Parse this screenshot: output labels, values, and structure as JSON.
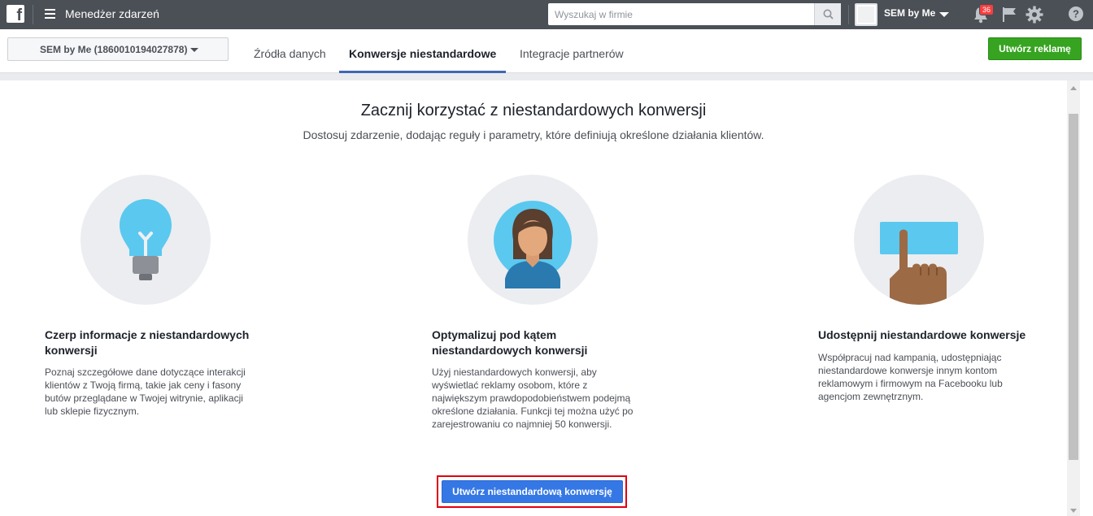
{
  "topbar": {
    "logo": "f",
    "app_title": "Menedżer zdarzeń",
    "search_placeholder": "Wyszukaj w firmie",
    "account_name": "SEM by Me",
    "notification_count": "36",
    "icons": [
      "facebook-logo",
      "menu-icon",
      "search-icon",
      "bell-icon",
      "flag-icon",
      "gear-icon",
      "help-icon"
    ]
  },
  "subnav": {
    "account_select": "SEM by Me (1860010194027878)",
    "tabs": [
      {
        "label": "Źródła danych",
        "active": false
      },
      {
        "label": "Konwersje niestandardowe",
        "active": true
      },
      {
        "label": "Integracje partnerów",
        "active": false
      }
    ],
    "create_ad": "Utwórz reklamę"
  },
  "main": {
    "headline": "Zacznij korzystać z niestandardowych konwersji",
    "subline": "Dostosuj zdarzenie, dodając reguły i parametry, które definiują określone działania klientów.",
    "cards": [
      {
        "icon": "lightbulb-icon",
        "title_lines": [
          "Czerp informacje z niestandardowych",
          "konwersji"
        ],
        "text_lines": [
          "Poznaj szczegółowe dane dotyczące interakcji",
          "klientów z Twoją firmą, takie jak ceny i fasony",
          "butów przeglądane w Twojej witrynie, aplikacji",
          "lub sklepie fizycznym."
        ]
      },
      {
        "icon": "person-icon",
        "title_lines": [
          "Optymalizuj pod kątem",
          "niestandardowych konwersji"
        ],
        "text_lines": [
          "Użyj niestandardowych konwersji, aby",
          "wyświetlać reklamy osobom, które z",
          "największym prawdopodobieństwem podejmą",
          "określone działania. Funkcji tej można użyć po",
          "zarejestrowaniu co najmniej 50 konwersji."
        ]
      },
      {
        "icon": "share-hand-icon",
        "title_lines": [
          "Udostępnij niestandardowe konwersje"
        ],
        "text_lines": [
          "Współpracuj nad kampanią, udostępniając",
          "niestandardowe konwersje innym kontom",
          "reklamowym i firmowym na Facebooku lub",
          "agencjom zewnętrznym."
        ]
      }
    ],
    "cta": "Utwórz niestandardową konwersję"
  },
  "colors": {
    "topbar": "#4b4f56",
    "accent_blue": "#3578e5",
    "green_button": "#36a420",
    "highlight_red": "#e0000d",
    "tab_underline": "#4267b2"
  }
}
